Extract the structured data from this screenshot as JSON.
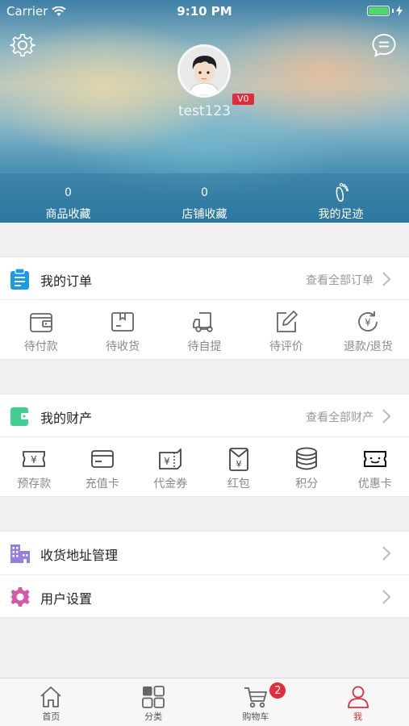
{
  "status_bar": {
    "carrier": "Carrier",
    "time": "9:10 PM"
  },
  "profile": {
    "username": "test123",
    "level": "V0"
  },
  "stats": [
    {
      "value": "0",
      "label": "商品收藏"
    },
    {
      "value": "0",
      "label": "店铺收藏"
    },
    {
      "label": "我的足迹",
      "icon": "footprint-icon"
    }
  ],
  "orders": {
    "title": "我的订单",
    "more": "查看全部订单",
    "items": [
      {
        "label": "待付款",
        "icon": "wallet-icon"
      },
      {
        "label": "待收货",
        "icon": "package-icon"
      },
      {
        "label": "待自提",
        "icon": "truck-icon"
      },
      {
        "label": "待评价",
        "icon": "edit-icon"
      },
      {
        "label": "退款/退货",
        "icon": "refund-icon"
      }
    ]
  },
  "assets": {
    "title": "我的财产",
    "more": "查看全部财产",
    "items": [
      {
        "label": "预存款",
        "icon": "deposit-icon"
      },
      {
        "label": "充值卡",
        "icon": "card-icon"
      },
      {
        "label": "代金券",
        "icon": "voucher-icon"
      },
      {
        "label": "红包",
        "icon": "red-envelope-icon"
      },
      {
        "label": "积分",
        "icon": "coins-icon"
      },
      {
        "label": "优惠卡",
        "icon": "coupon-icon"
      }
    ]
  },
  "settings": [
    {
      "label": "收货地址管理",
      "icon": "building-icon"
    },
    {
      "label": "用户设置",
      "icon": "gear-icon"
    }
  ],
  "tabbar": {
    "items": [
      {
        "label": "首页",
        "icon": "home-icon"
      },
      {
        "label": "分类",
        "icon": "category-icon"
      },
      {
        "label": "购物车",
        "icon": "cart-icon",
        "badge": "2"
      },
      {
        "label": "我",
        "icon": "user-icon",
        "active": true
      }
    ]
  },
  "colors": {
    "accent": "#e02c3c",
    "order_icon": "#1a9be8",
    "asset_icon": "#3fcf8e",
    "address_icon": "#9a7de0",
    "settings_icon": "#d45aa8"
  }
}
